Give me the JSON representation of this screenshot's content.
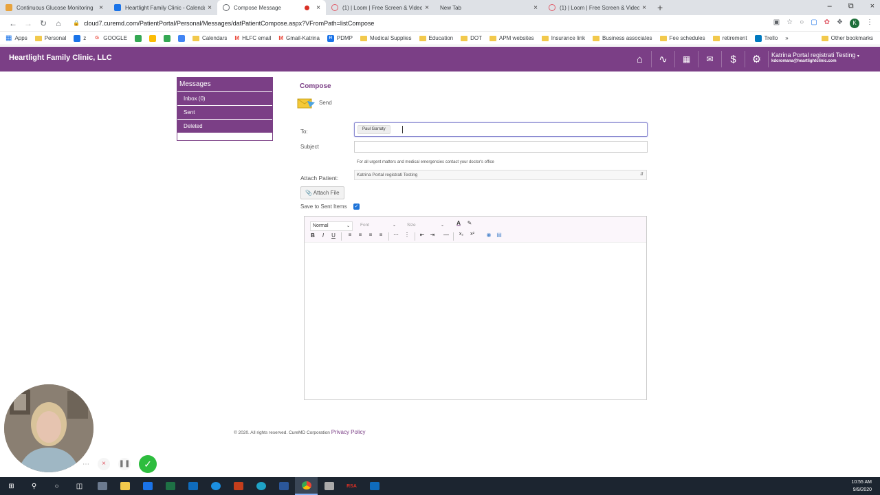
{
  "browser": {
    "tabs": [
      {
        "title": "Continuous Glucose Monitoring",
        "icon": "doc-icon",
        "color": "#e8a33d"
      },
      {
        "title": "Heartlight Family Clinic - Calenda",
        "icon": "calendar-icon",
        "color": "#1a73e8"
      },
      {
        "title": "Compose Message",
        "icon": "globe-icon",
        "color": "#5f6368"
      },
      {
        "title": "(1) | Loom | Free Screen & Video",
        "icon": "loom-icon",
        "color": "#e05a67"
      },
      {
        "title": "New Tab",
        "icon": "blank-icon",
        "color": "#ffffff"
      },
      {
        "title": "(1) | Loom | Free Screen & Video",
        "icon": "loom-icon",
        "color": "#e05a67"
      }
    ],
    "url": "cloud7.curemd.com/PatientPortal/Personal/Messages/datPatientCompose.aspx?VFromPath=listCompose",
    "profile_initial": "K",
    "bookmarks": [
      {
        "label": "Apps",
        "type": "apps"
      },
      {
        "label": "Personal",
        "type": "folder"
      },
      {
        "label": "z",
        "type": "icon",
        "color": "#1a73e8"
      },
      {
        "label": "GOOGLE",
        "type": "icon",
        "color": "#ea4335"
      },
      {
        "label": "",
        "type": "icon",
        "color": "#34a853"
      },
      {
        "label": "",
        "type": "icon",
        "color": "#fbbc05"
      },
      {
        "label": "",
        "type": "icon",
        "color": "#34a853"
      },
      {
        "label": "",
        "type": "icon",
        "color": "#4285f4"
      },
      {
        "label": "Calendars",
        "type": "folder"
      },
      {
        "label": "HLFC email",
        "type": "icon",
        "color": "#ea4335"
      },
      {
        "label": "Gmail-Katrina",
        "type": "icon",
        "color": "#ea4335"
      },
      {
        "label": "PDMP",
        "type": "icon",
        "color": "#1a73e8"
      },
      {
        "label": "Medical Supplies",
        "type": "folder"
      },
      {
        "label": "Education",
        "type": "folder"
      },
      {
        "label": "DOT",
        "type": "folder"
      },
      {
        "label": "APM websites",
        "type": "folder"
      },
      {
        "label": "Insurance link",
        "type": "folder"
      },
      {
        "label": "Business associates",
        "type": "folder"
      },
      {
        "label": "Fee schedules",
        "type": "folder"
      },
      {
        "label": "retirement",
        "type": "folder"
      },
      {
        "label": "Trello",
        "type": "icon",
        "color": "#0079bf"
      }
    ],
    "other_bookmarks": "Other bookmarks"
  },
  "app": {
    "brand": "Heartlight Family Clinic, LLC",
    "header_color": "#7b3f86",
    "user_name": "Katrina Portal registrati Testing",
    "user_email": "kdcromana@heartlightclinic.com"
  },
  "sidebar": {
    "title": "Messages",
    "items": [
      "Inbox (0)",
      "Sent",
      "Deleted"
    ]
  },
  "compose": {
    "title": "Compose",
    "send_label": "Send",
    "to_label": "To:",
    "to_recipient": "Paul Garraty",
    "subject_label": "Subject",
    "subject_value": "",
    "notice": "For all urgent matters and medical emergencies contact your doctor's office",
    "attach_patient_label": "Attach Patient:",
    "attach_patient_value": "Katrina Portal registrati Testing",
    "attach_file_label": "Attach File",
    "save_sent_label": "Save to Sent Items",
    "save_sent_checked": true
  },
  "editor": {
    "format_value": "Normal",
    "font_placeholder": "Font",
    "size_placeholder": "Size"
  },
  "footer": {
    "copyright": "© 2020. All rights reserved. CureMD Corporation",
    "privacy": "Privacy Policy"
  },
  "taskbar": {
    "time": "10:55 AM",
    "date": "9/9/2020"
  }
}
